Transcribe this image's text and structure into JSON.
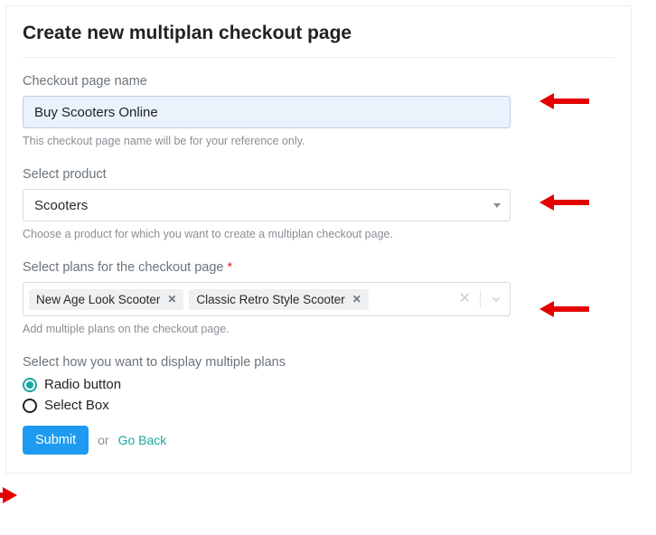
{
  "header": {
    "title": "Create new multiplan checkout page"
  },
  "name_field": {
    "label": "Checkout page name",
    "value": "Buy Scooters Online",
    "helper": "This checkout page name will be for your reference only."
  },
  "product_field": {
    "label": "Select product",
    "value": "Scooters",
    "helper": "Choose a product for which you want to create a multiplan checkout page."
  },
  "plans_field": {
    "label": "Select plans for the checkout page ",
    "required_marker": "*",
    "tags": [
      "New Age Look Scooter",
      "Classic Retro Style Scooter"
    ],
    "helper": "Add multiple plans on the checkout page."
  },
  "display_field": {
    "label": "Select how you want to display multiple plans",
    "options": [
      "Radio button",
      "Select Box"
    ],
    "selected_index": 0
  },
  "actions": {
    "submit": "Submit",
    "or": "or",
    "go_back": "Go Back"
  }
}
